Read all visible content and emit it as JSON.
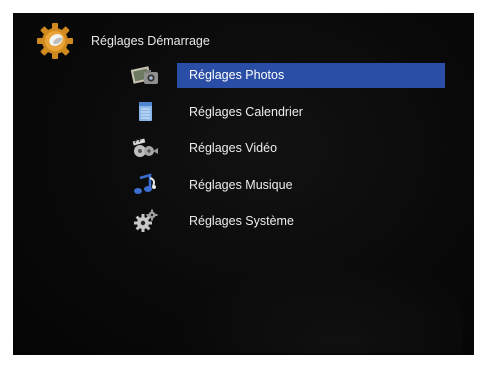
{
  "header": {
    "title": "Réglages Démarrage",
    "icon": "gear-icon"
  },
  "menu": {
    "items": [
      {
        "label": "Réglages Photos",
        "icon": "photos-icon",
        "selected": true
      },
      {
        "label": "Réglages Calendrier",
        "icon": "calendar-icon",
        "selected": false
      },
      {
        "label": "Réglages Vidéo",
        "icon": "video-icon",
        "selected": false
      },
      {
        "label": "Réglages Musique",
        "icon": "music-icon",
        "selected": false
      },
      {
        "label": "Réglages Système",
        "icon": "system-gears-icon",
        "selected": false
      }
    ]
  },
  "colors": {
    "selection": "#2a4ea6",
    "background": "#0a0a0a",
    "text": "#ededed"
  }
}
